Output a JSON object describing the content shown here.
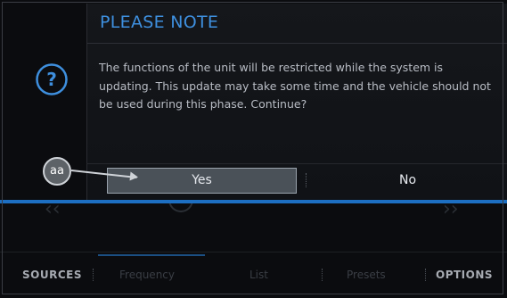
{
  "dialog": {
    "title": "PLEASE NOTE",
    "message": "The functions of the unit will be restricted while the system is updating. This update may take some time and the vehicle should not be used during this phase. Continue?",
    "yes_label": "Yes",
    "no_label": "No"
  },
  "callout": {
    "label": "aa"
  },
  "bottom_bar": {
    "sources_label": "SOURCES",
    "options_label": "OPTIONS",
    "tabs": [
      {
        "label": "Frequency",
        "active": true
      },
      {
        "label": "List"
      },
      {
        "label": "Presets"
      }
    ]
  },
  "colors": {
    "accent_blue": "#1d6fc2",
    "title_blue": "#3e8fde",
    "background": "#0b0c0f",
    "selected_button": "#4a5158"
  },
  "icons": {
    "info": "question-icon",
    "left_nav": "chevron-left-icon",
    "right_nav": "chevron-right-icon"
  }
}
